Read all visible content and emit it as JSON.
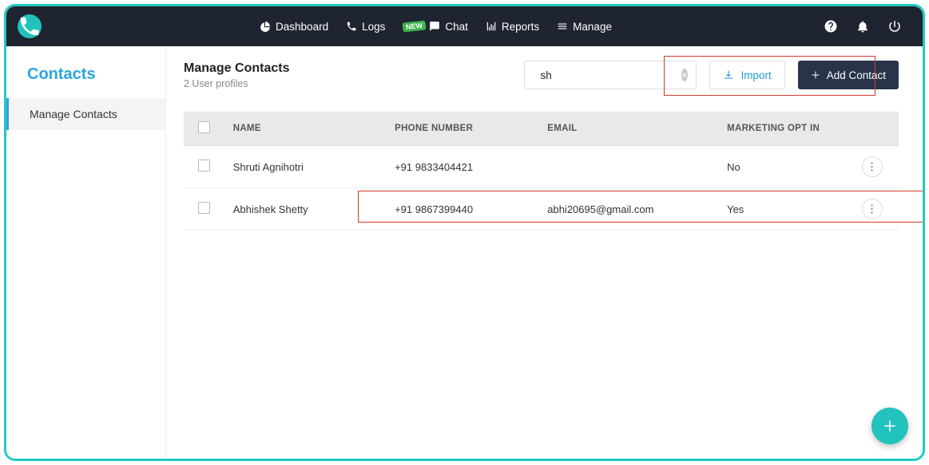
{
  "nav": {
    "dashboard": "Dashboard",
    "logs": "Logs",
    "chat": "Chat",
    "chat_badge": "NEW",
    "reports": "Reports",
    "manage": "Manage"
  },
  "sidebar": {
    "title": "Contacts",
    "items": [
      {
        "label": "Manage Contacts"
      }
    ]
  },
  "page": {
    "title": "Manage Contacts",
    "subtitle": "2 User profiles"
  },
  "search": {
    "value": "sh"
  },
  "buttons": {
    "import": "Import",
    "add": "Add Contact"
  },
  "table": {
    "headers": {
      "name": "NAME",
      "phone": "PHONE NUMBER",
      "email": "EMAIL",
      "optin": "MARKETING OPT IN"
    },
    "rows": [
      {
        "name": "Shruti Agnihotri",
        "phone": "+91 9833404421",
        "email": "",
        "optin": "No"
      },
      {
        "name": "Abhishek Shetty",
        "phone": "+91 9867399440",
        "email": "abhi20695@gmail.com",
        "optin": "Yes"
      }
    ]
  }
}
